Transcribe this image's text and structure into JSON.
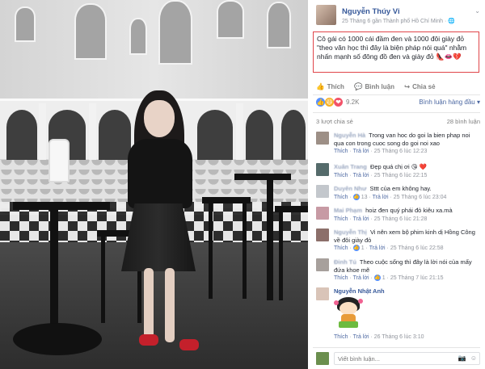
{
  "post": {
    "author": "Nguyễn Thúy Vi",
    "meta": "25 Tháng 6 gần Thành phố Hồ Chí Minh · 🌐",
    "text": "Cô gái có 1000 cái đầm đen và 1000 đôi giày đỏ \"theo văn học thì đây là biện pháp nói quá\" nhằm nhấn mạnh số đông đồ đen và giày đỏ 👠👄💔"
  },
  "actions": {
    "like": "Thích",
    "comment": "Bình luận",
    "share": "Chia sẻ"
  },
  "reactions": {
    "count": "9.2K",
    "sort_label": "Bình luận hàng đầu ▾"
  },
  "stats": {
    "shares": "3 lượt chia sẻ",
    "comments": "28 bình luận"
  },
  "comments": [
    {
      "author": "Nguyễn Hà",
      "text": "Trong van hoc do goi la bien phap noi qua con trong cuoc song do goi noi xao",
      "like": "Thích",
      "reply": "Trả lời",
      "time": "25 Tháng 6 lúc 12:23",
      "reacts": ""
    },
    {
      "author": "Xuân Trang",
      "text": "Đẹp quá chị ơi 😘 ❤️",
      "like": "Thích",
      "reply": "Trả lời",
      "time": "25 Tháng 6 lúc 22:15",
      "reacts": ""
    },
    {
      "author": "Duyên Như",
      "text": "Sttt của em không hay.",
      "like": "Thích",
      "reply": "Trả lời",
      "time": "25 Tháng 6 lúc 23:04",
      "reacts": "13"
    },
    {
      "author": "Mai Phạm",
      "text": "hoiz đen quý phái đỏ kiêu xa.mà",
      "like": "Thích",
      "reply": "Trả lời",
      "time": "25 Tháng 6 lúc 21:28",
      "reacts": ""
    },
    {
      "author": "Nguyễn Thị",
      "text": "Vi nên xem bộ phim kinh dị Hồng Công về đôi giày đỏ",
      "like": "Thích",
      "reply": "Trả lời",
      "time": "25 Tháng 6 lúc 22:58",
      "reacts": "1"
    },
    {
      "author": "Đinh Tú",
      "text": "Theo cuộc sống thì đây là lời nói của mấy đứa khoe mẽ",
      "like": "Thích",
      "reply": "Trả lời",
      "time": "25 Tháng 7 lúc 21:15",
      "reacts": "1"
    },
    {
      "author": "Nguyễn Nhật Anh",
      "text": "",
      "like": "Thích",
      "reply": "Trả lời",
      "time": "26 Tháng 6 lúc 3:10",
      "reacts": ""
    }
  ],
  "composer": {
    "placeholder": "Viết bình luận..."
  },
  "icons": {
    "like": "thumbs-up-icon",
    "comment": "speech-bubble-icon",
    "share": "share-arrow-icon",
    "globe": "globe-icon",
    "camera": "camera-icon",
    "smile": "smile-icon"
  },
  "colors": {
    "link_blue": "#365899",
    "highlight_border": "#e0454a",
    "reaction_like": "#5890ff",
    "reaction_haha": "#f7b125",
    "reaction_love": "#f25268"
  }
}
